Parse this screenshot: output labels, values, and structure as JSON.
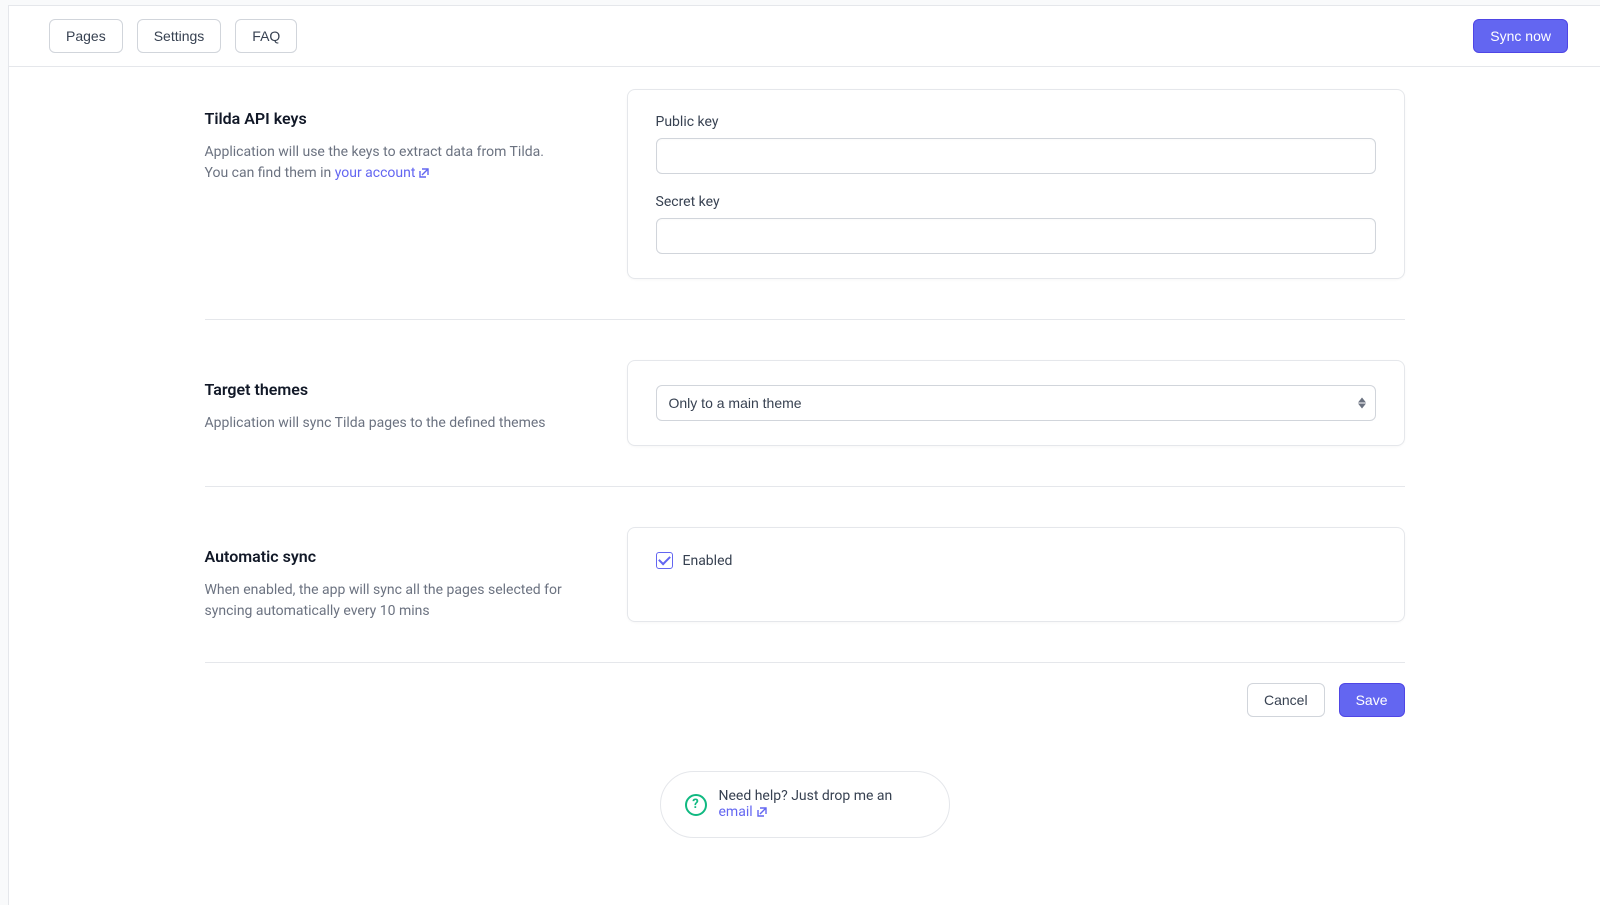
{
  "topbar": {
    "tabs": [
      "Pages",
      "Settings",
      "FAQ"
    ],
    "sync_now": "Sync now"
  },
  "sections": {
    "api_keys": {
      "title": "Tilda API keys",
      "desc_before": "Application will use the keys to extract data from Tilda. You can find them in ",
      "desc_link": "your account",
      "public_key_label": "Public key",
      "public_key_value": "",
      "secret_key_label": "Secret key",
      "secret_key_value": ""
    },
    "target_themes": {
      "title": "Target themes",
      "desc": "Application will sync Tilda pages to the defined themes",
      "selected": "Only to a main theme"
    },
    "automatic_sync": {
      "title": "Automatic sync",
      "desc": "When enabled, the app will sync all the pages selected for syncing automatically every 10 mins",
      "enabled_label": "Enabled",
      "enabled_checked": true
    }
  },
  "actions": {
    "cancel": "Cancel",
    "save": "Save"
  },
  "help": {
    "text_before": "Need help? Just drop me an ",
    "link": "email"
  }
}
